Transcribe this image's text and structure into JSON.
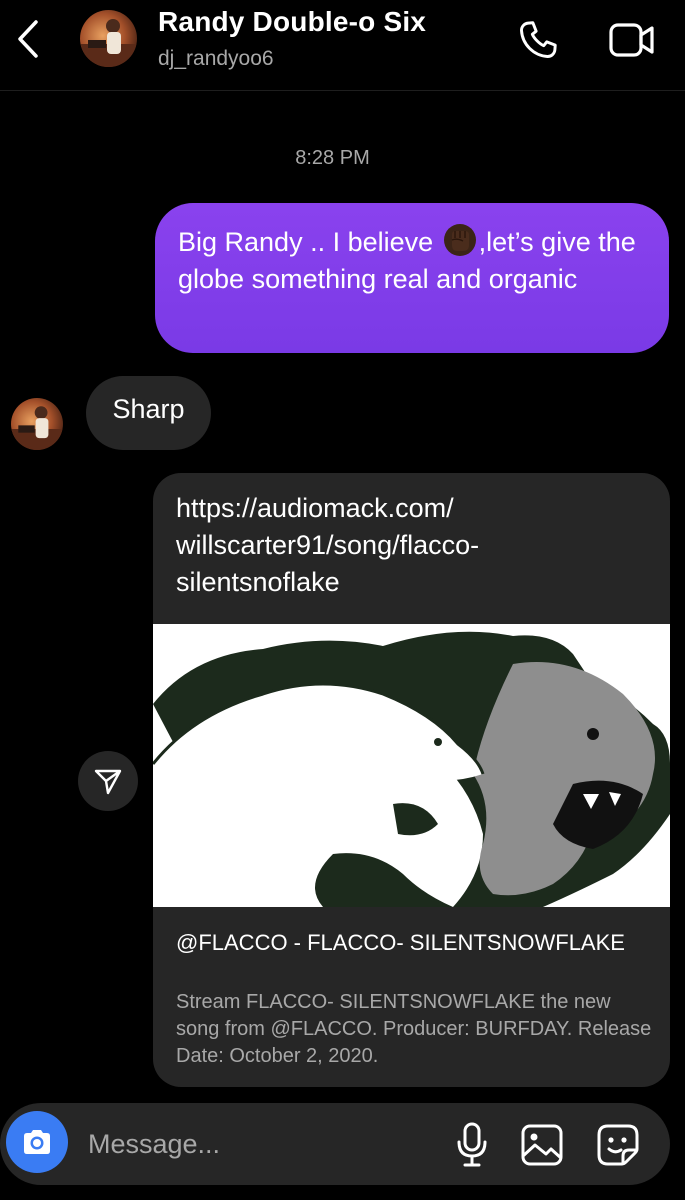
{
  "header": {
    "title": "Randy Double-o Six",
    "username": "dj_randyoo6",
    "icons": {
      "back": "chevron-left-icon",
      "call": "phone-icon",
      "video": "video-camera-icon"
    }
  },
  "thread": {
    "timestamp": "8:28 PM",
    "outgoing_message": {
      "text_before_emoji": "Big Randy .. I believe ",
      "emoji": "raised-fist-dark-skin",
      "text_after_emoji": ",let’s give the globe something real and organic"
    },
    "incoming_message": {
      "text": "Sharp"
    },
    "shared_link": {
      "url": "https://audiomack.com/ willscarter91/song/flacco- silentsnoflake",
      "title": "@FLACCO - FLACCO- SILENTSNOWFLAKE",
      "description": "Stream FLACCO- SILENTSNOWFLAKE the new song from @FLACCO. Producer: BURFDAY. Release Date: October 2, 2020."
    }
  },
  "composer": {
    "placeholder": "Message...",
    "icons": {
      "camera": "camera-icon",
      "mic": "microphone-icon",
      "gallery": "image-icon",
      "sticker": "sticker-icon"
    }
  },
  "colors": {
    "background": "#000000",
    "outgoing_bubble": "#8a42ee",
    "incoming_bubble": "#262626",
    "camera_button": "#3a7cf3",
    "secondary_text": "#a8a8a8"
  }
}
